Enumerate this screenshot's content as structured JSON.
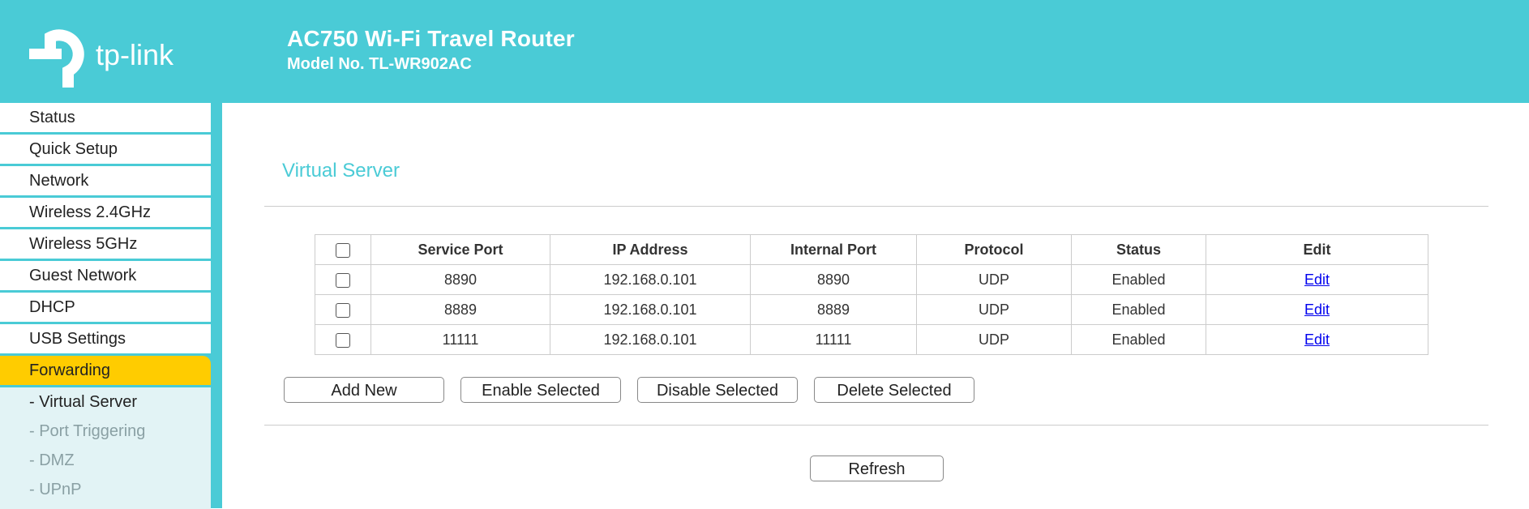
{
  "header": {
    "logo_text": "tp-link",
    "title": "AC750 Wi-Fi Travel Router",
    "model": "Model No. TL-WR902AC"
  },
  "sidebar": {
    "items": [
      {
        "label": "Status"
      },
      {
        "label": "Quick Setup"
      },
      {
        "label": "Network"
      },
      {
        "label": "Wireless 2.4GHz"
      },
      {
        "label": "Wireless 5GHz"
      },
      {
        "label": "Guest Network"
      },
      {
        "label": "DHCP"
      },
      {
        "label": "USB Settings"
      },
      {
        "label": "Forwarding",
        "active": true
      }
    ],
    "subitems": [
      {
        "label": "- Virtual Server",
        "current": true
      },
      {
        "label": "- Port Triggering"
      },
      {
        "label": "- DMZ"
      },
      {
        "label": "- UPnP"
      }
    ]
  },
  "main": {
    "section_title": "Virtual Server",
    "table": {
      "headers": [
        "Service Port",
        "IP Address",
        "Internal Port",
        "Protocol",
        "Status",
        "Edit"
      ],
      "rows": [
        {
          "service_port": "8890",
          "ip": "192.168.0.101",
          "internal_port": "8890",
          "protocol": "UDP",
          "status": "Enabled",
          "edit": "Edit"
        },
        {
          "service_port": "8889",
          "ip": "192.168.0.101",
          "internal_port": "8889",
          "protocol": "UDP",
          "status": "Enabled",
          "edit": "Edit"
        },
        {
          "service_port": "11111",
          "ip": "192.168.0.101",
          "internal_port": "11111",
          "protocol": "UDP",
          "status": "Enabled",
          "edit": "Edit"
        }
      ]
    },
    "buttons": {
      "add_new": "Add New",
      "enable_selected": "Enable Selected",
      "disable_selected": "Disable Selected",
      "delete_selected": "Delete Selected",
      "refresh": "Refresh"
    }
  },
  "colors": {
    "accent": "#4acbd6",
    "active_menu": "#ffcc00",
    "submenu_bg": "#e2f3f5",
    "link": "#0000ee"
  }
}
